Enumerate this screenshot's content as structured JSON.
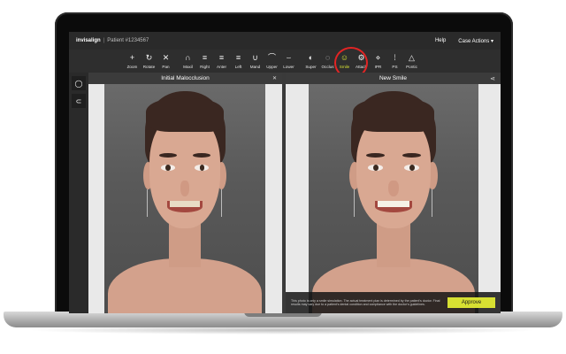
{
  "header": {
    "brand": "invisalign",
    "patient": "Patient #1234567",
    "help": "Help",
    "case_actions": "Case Actions"
  },
  "toolbar": [
    {
      "label": "Zoom",
      "icon": "plus-minus-icon"
    },
    {
      "label": "Rotate",
      "icon": "rotate-icon"
    },
    {
      "label": "Pan",
      "icon": "pan-icon"
    },
    {
      "label": "Maxil",
      "icon": "maxilla-icon"
    },
    {
      "label": "Right",
      "icon": "right-view-icon"
    },
    {
      "label": "Anter",
      "icon": "anterior-view-icon"
    },
    {
      "label": "Left",
      "icon": "left-view-icon"
    },
    {
      "label": "Mand",
      "icon": "mandible-icon"
    },
    {
      "label": "Upper",
      "icon": "upper-arch-icon"
    },
    {
      "label": "Lower",
      "icon": "lower-arch-icon"
    },
    {
      "label": "Super",
      "icon": "superimpose-icon"
    },
    {
      "label": "Occlus",
      "icon": "occlusion-icon"
    },
    {
      "label": "Smile",
      "icon": "smile-icon"
    },
    {
      "label": "Attach",
      "icon": "attachments-icon"
    },
    {
      "label": "IPR",
      "icon": "ipr-icon"
    },
    {
      "label": "PS",
      "icon": "ps-icon"
    },
    {
      "label": "Pontic",
      "icon": "pontic-icon"
    }
  ],
  "panels": {
    "left_title": "Initial Malocclusion",
    "right_title": "New Smile"
  },
  "footer": {
    "disclaimer": "This photo is only a smile simulation. The actual treatment plan is determined by the patient's doctor. Final results may vary due to a patient's dental condition and compliance with the doctor's guidelines.",
    "approve": "Approve"
  },
  "colors": {
    "accent": "#d7e032",
    "highlight_ring": "#e22424"
  }
}
